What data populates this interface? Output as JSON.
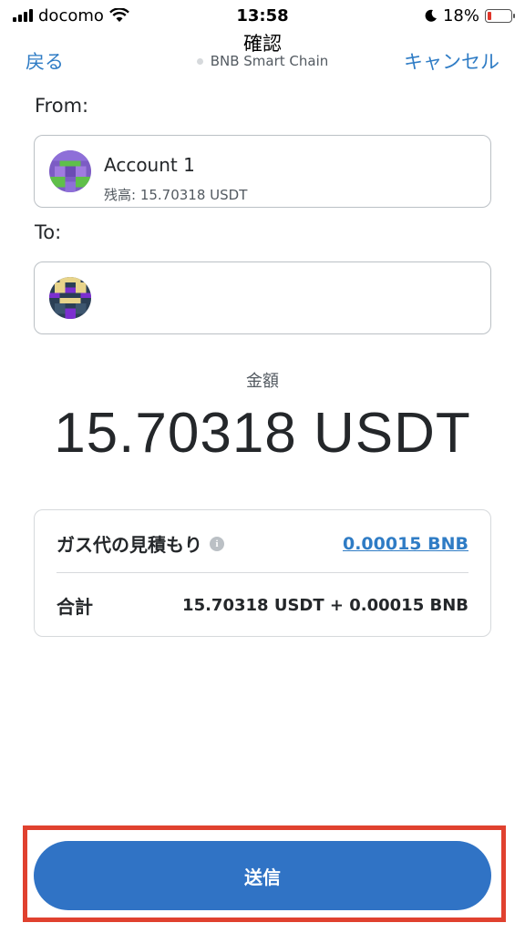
{
  "status_bar": {
    "carrier": "docomo",
    "time": "13:58",
    "battery_percent": "18%",
    "battery_level": 0.18
  },
  "nav": {
    "back_label": "戻る",
    "title": "確認",
    "network": "BNB Smart Chain",
    "cancel_label": "キャンセル"
  },
  "from": {
    "label": "From:",
    "account_name": "Account 1",
    "balance": "残高: 15.70318 USDT"
  },
  "to": {
    "label": "To:"
  },
  "amount": {
    "label": "金額",
    "value": "15.70318 USDT"
  },
  "fees": {
    "gas_label": "ガス代の見積もり",
    "gas_value": "0.00015 BNB",
    "total_label": "合計",
    "total_value": "15.70318 USDT + 0.00015 BNB"
  },
  "actions": {
    "send_label": "送信"
  },
  "colors": {
    "accent": "#3073c5",
    "link": "#2f7cc5",
    "highlight": "#e0412f"
  }
}
